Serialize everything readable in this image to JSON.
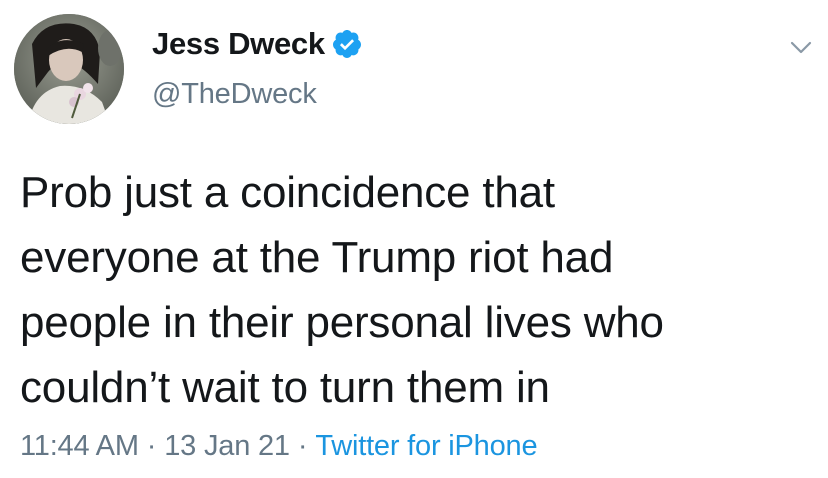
{
  "tweet": {
    "author": {
      "display_name": "Jess Dweck",
      "handle": "@TheDweck",
      "verified": true,
      "avatar_icon": "profile-photo"
    },
    "text_lines": [
      "Prob just a coincidence that",
      "everyone at the Trump riot had",
      "people in their personal lives who",
      "couldn’t wait to turn them in"
    ],
    "time": "11:44 AM",
    "date": "13 Jan 21",
    "separator": "·",
    "source": "Twitter for iPhone",
    "menu_icon": "chevron-down-icon"
  },
  "colors": {
    "text": "#14171a",
    "secondary": "#657786",
    "link": "#1b95e0",
    "verified_badge": "#1da1f2"
  }
}
